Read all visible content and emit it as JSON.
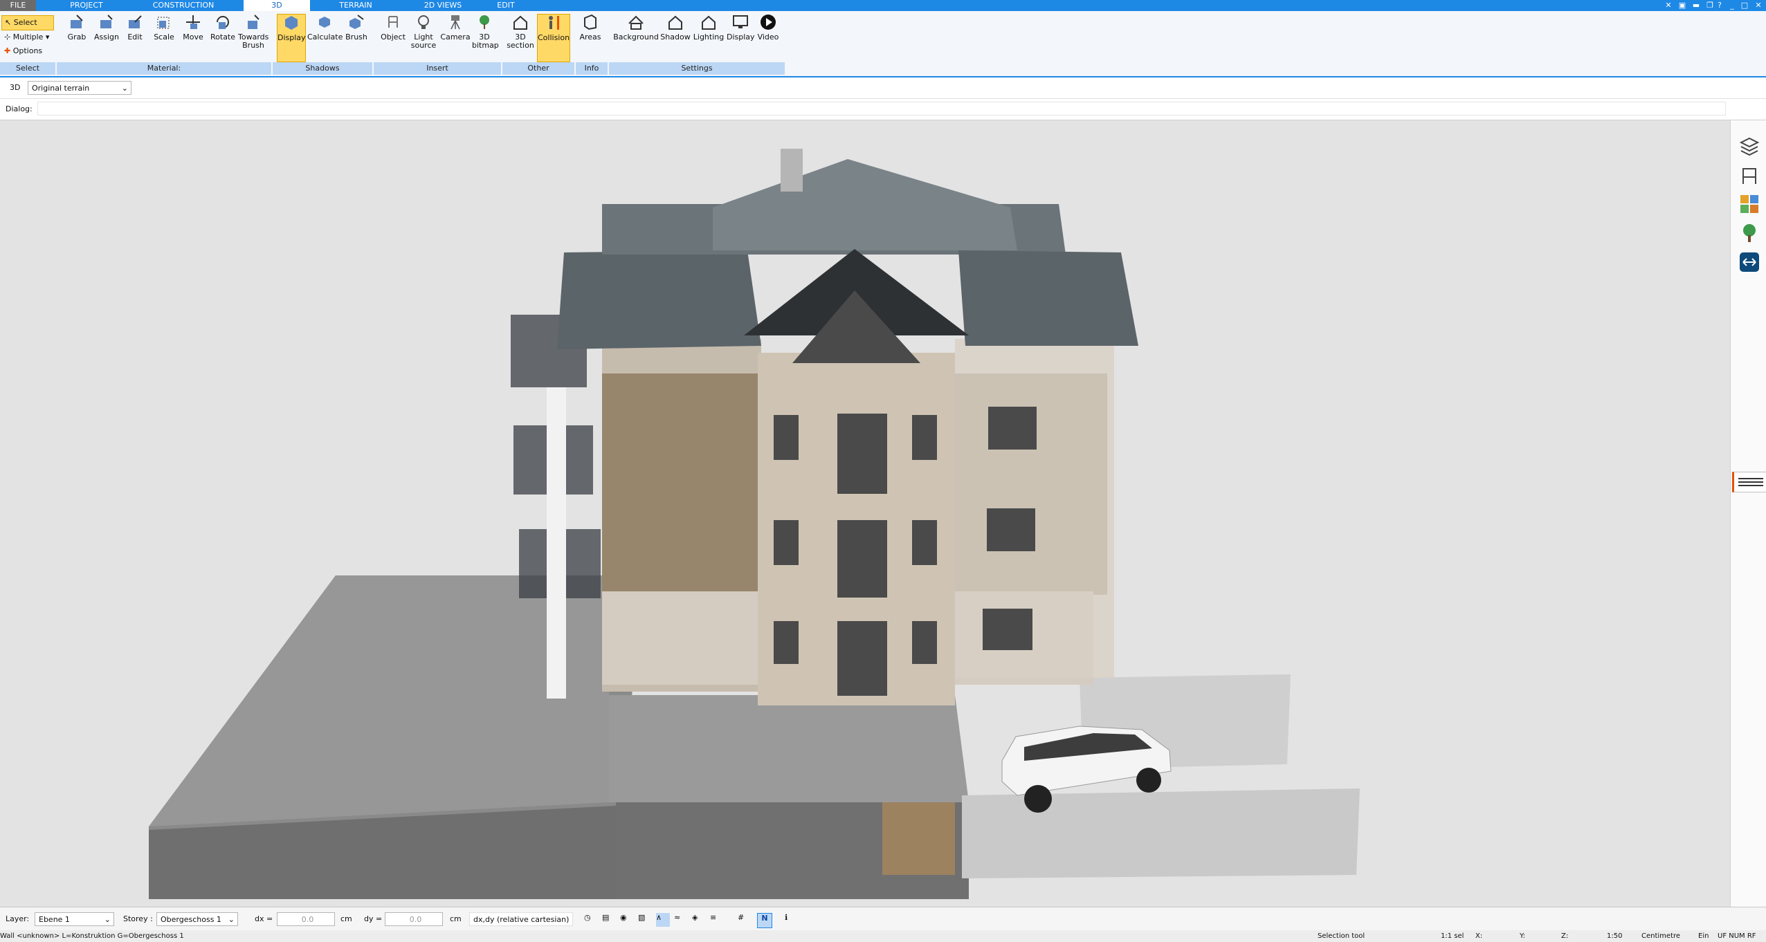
{
  "tabs": [
    "FILE",
    "PROJECT",
    "CONSTRUCTION",
    "3D",
    "TERRAIN",
    "2D VIEWS",
    "EDIT"
  ],
  "active_tab": "3D",
  "select_group": {
    "select": "Select",
    "multiple": "Multiple",
    "options": "Options",
    "group_label": "Select"
  },
  "material_group": {
    "grab": "Grab",
    "assign": "Assign",
    "edit": "Edit",
    "scale": "Scale",
    "move": "Move",
    "rotate": "Rotate",
    "towards_brush": "Towards Brush",
    "group_label": "Material:"
  },
  "shadows_group": {
    "display": "Display",
    "calculate": "Calculate",
    "brush": "Brush",
    "group_label": "Shadows"
  },
  "insert_group": {
    "object": "Object",
    "light_source": "Light source",
    "camera": "Camera",
    "bitmap": "3D bitmap",
    "group_label": "Insert"
  },
  "other_group": {
    "section": "3D section",
    "collision": "Collision",
    "group_label": "Other"
  },
  "info_group": {
    "areas": "Areas",
    "group_label": "Info"
  },
  "settings_group": {
    "background": "Background",
    "shadow": "Shadow",
    "lighting": "Lighting",
    "display": "Display",
    "video": "Video",
    "group_label": "Settings"
  },
  "view_row": {
    "mode": "3D",
    "terrain_select": "Original terrain"
  },
  "dialog_row": {
    "label": "Dialog:"
  },
  "status": {
    "layer_label": "Layer:",
    "layer_value": "Ebene 1",
    "storey_label": "Storey :",
    "storey_value": "Obergeschoss 1",
    "dx_label": "dx =",
    "dx_value": "0.0",
    "dx_unit": "cm",
    "dy_label": "dy =",
    "dy_value": "0.0",
    "dy_unit": "cm",
    "coord_mode": "dx,dy (relative cartesian)"
  },
  "bottom": {
    "info": "Wall <unknown> L=Konstruktion G=Obergeschoss 1",
    "tool": "Selection tool",
    "sel": "1:1 sel",
    "x": "X:",
    "y": "Y:",
    "z": "Z:",
    "scale": "1:50",
    "unit": "Centimetre",
    "ein": "Ein",
    "flags": "UF NUM RF"
  },
  "colors": {
    "accent": "#1e88e5",
    "highlight": "#ffd966",
    "group_bar": "#bcd7f5"
  }
}
